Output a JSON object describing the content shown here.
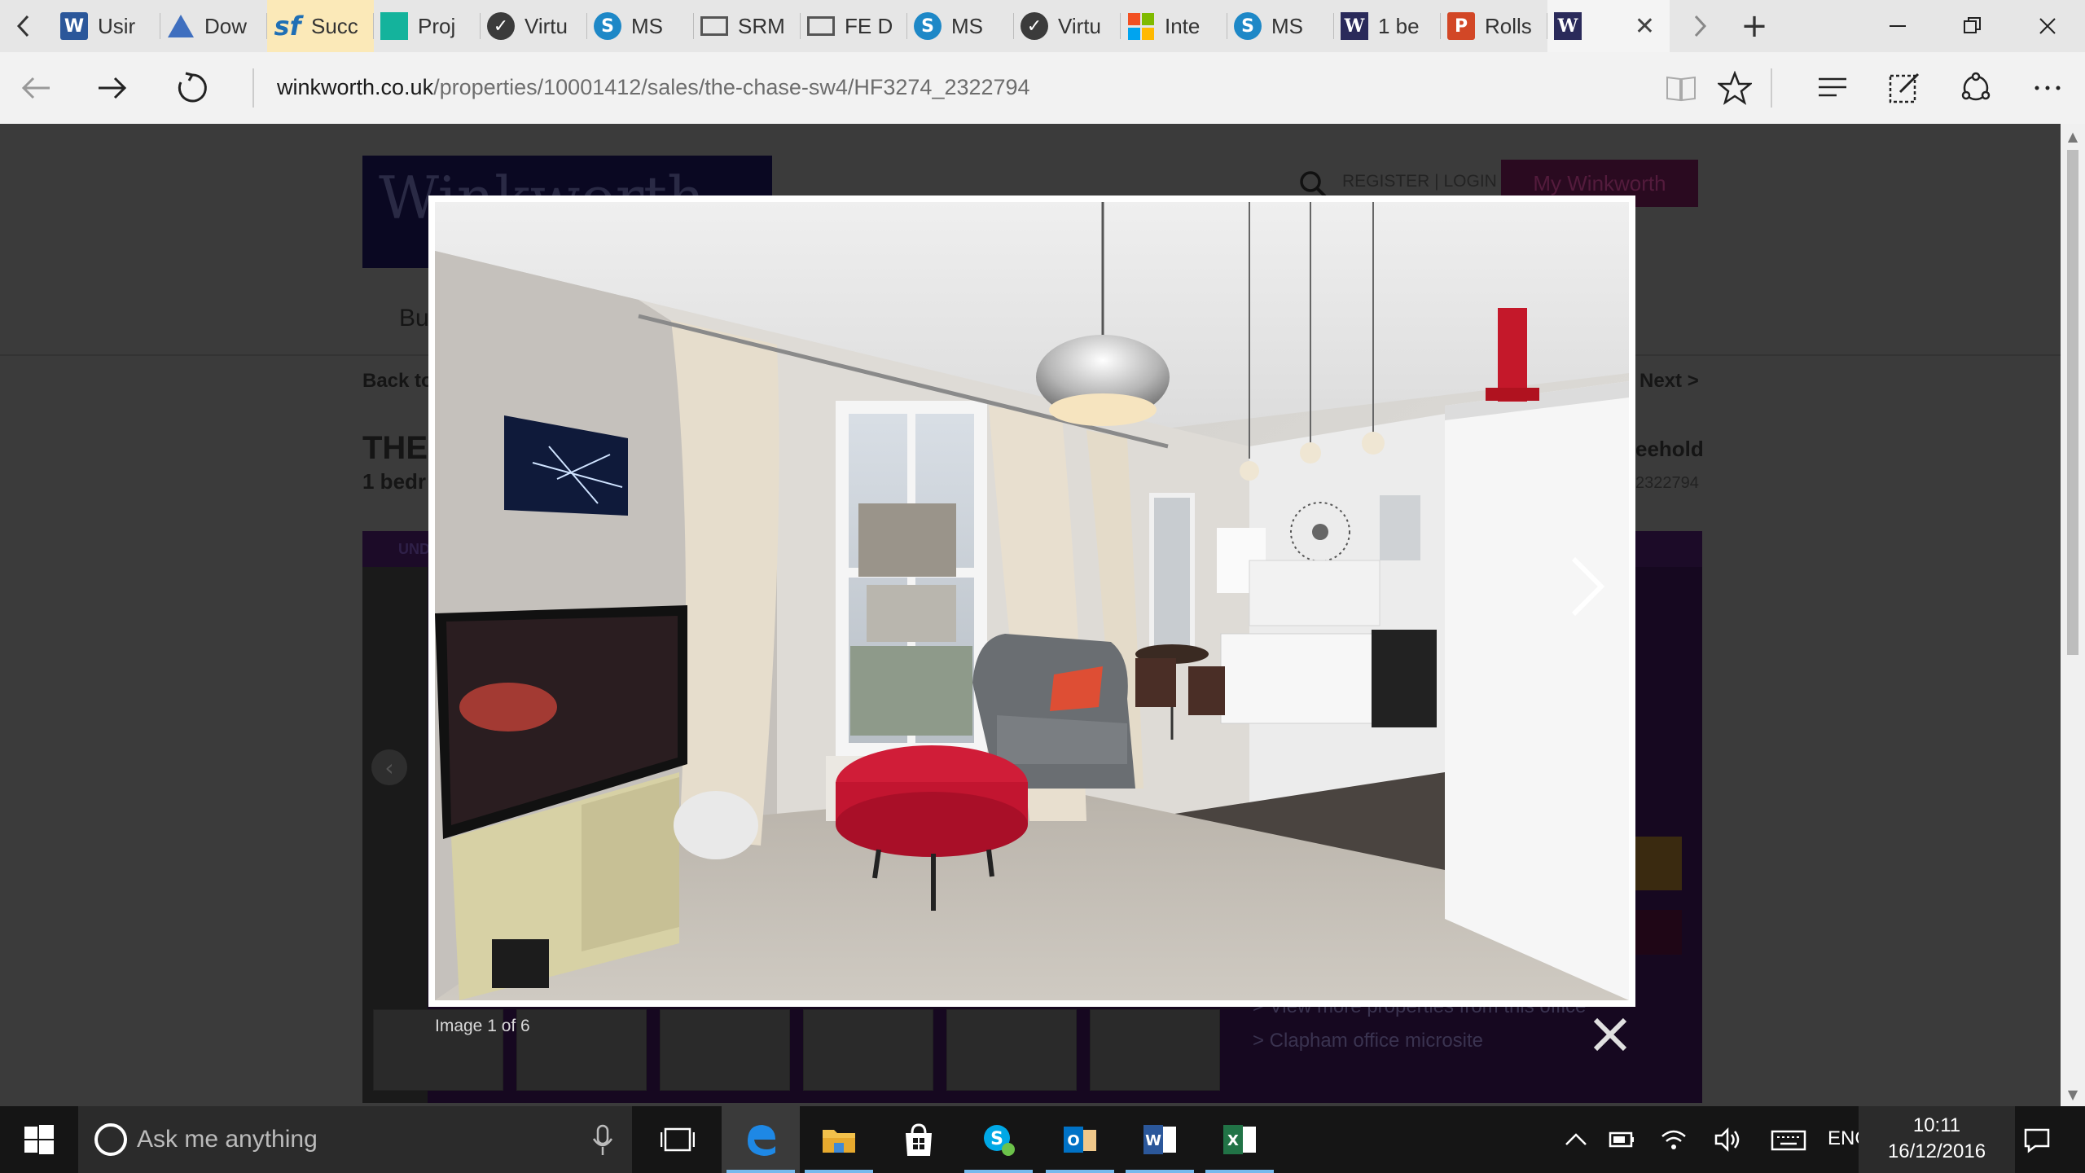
{
  "browser": {
    "tabs": [
      {
        "title": "Usir",
        "icon": "word-icon"
      },
      {
        "title": "Dow",
        "icon": "drive-triangle-icon"
      },
      {
        "title": "Succ",
        "icon": "salesforce-icon",
        "highlight": true
      },
      {
        "title": "Proj",
        "icon": "teal-square-icon"
      },
      {
        "title": "Virtu",
        "icon": "virtual-check-icon"
      },
      {
        "title": "MS",
        "icon": "sharepoint-icon"
      },
      {
        "title": "SRM",
        "icon": "window-icon"
      },
      {
        "title": "FE D",
        "icon": "window-icon"
      },
      {
        "title": "MS",
        "icon": "sharepoint-icon"
      },
      {
        "title": "Virtu",
        "icon": "virtual-check-icon"
      },
      {
        "title": "Inte",
        "icon": "microsoft-logo-icon"
      },
      {
        "title": "MS",
        "icon": "sharepoint-icon"
      },
      {
        "title": "1 be",
        "icon": "winkworth-w-icon"
      },
      {
        "title": "Rolls",
        "icon": "powerpoint-icon"
      }
    ],
    "url_host": "winkworth.co.uk",
    "url_path": "/properties/10001412/sales/the-chase-sw4/HF3274_2322794"
  },
  "page": {
    "logo_text": "Winkworth",
    "register_login": "REGISTER | LOGIN",
    "my_winkworth": "My Winkworth",
    "nav_partial": "Bu",
    "back_partial": "Back to",
    "next": "Next >",
    "title_partial": "THE",
    "bedrooms_partial": "1 bedr",
    "tenure_partial": "eehold",
    "ref_partial": "2322794",
    "status_partial": "UND",
    "more_properties": "> View more properties from this office",
    "office_microsite": "> Clapham office microsite"
  },
  "lightbox": {
    "caption": "Image 1 of 6"
  },
  "taskbar": {
    "search_placeholder": "Ask me anything",
    "language": "ENG",
    "time": "10:11",
    "date": "16/12/2016"
  }
}
